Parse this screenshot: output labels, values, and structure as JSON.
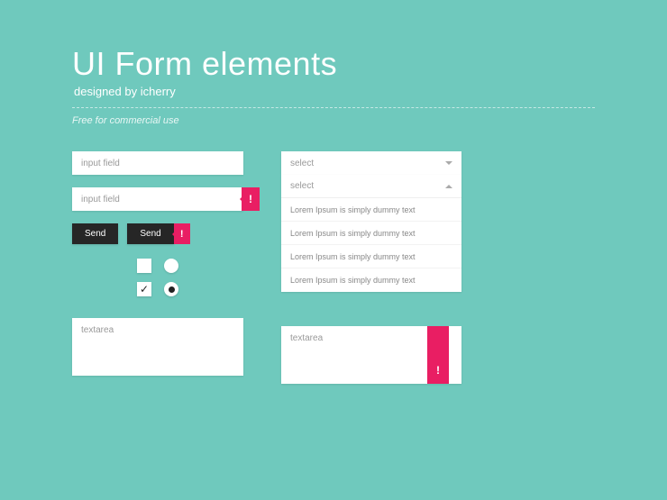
{
  "header": {
    "title": "UI Form elements",
    "subtitle": "designed by icherry",
    "note": "Free for commercial use"
  },
  "left": {
    "input1": "input field",
    "input2": "input field",
    "btn1": "Send",
    "btn2": "Send",
    "textarea": "textarea"
  },
  "right": {
    "select1": "select",
    "select2": "select",
    "option1": "Lorem Ipsum is simply dummy text",
    "option2": "Lorem Ipsum is simply dummy text",
    "option3": "Lorem Ipsum is simply dummy text",
    "option4": "Lorem Ipsum is simply dummy text",
    "textarea": "textarea"
  },
  "icons": {
    "bang": "!",
    "check": "✓"
  }
}
